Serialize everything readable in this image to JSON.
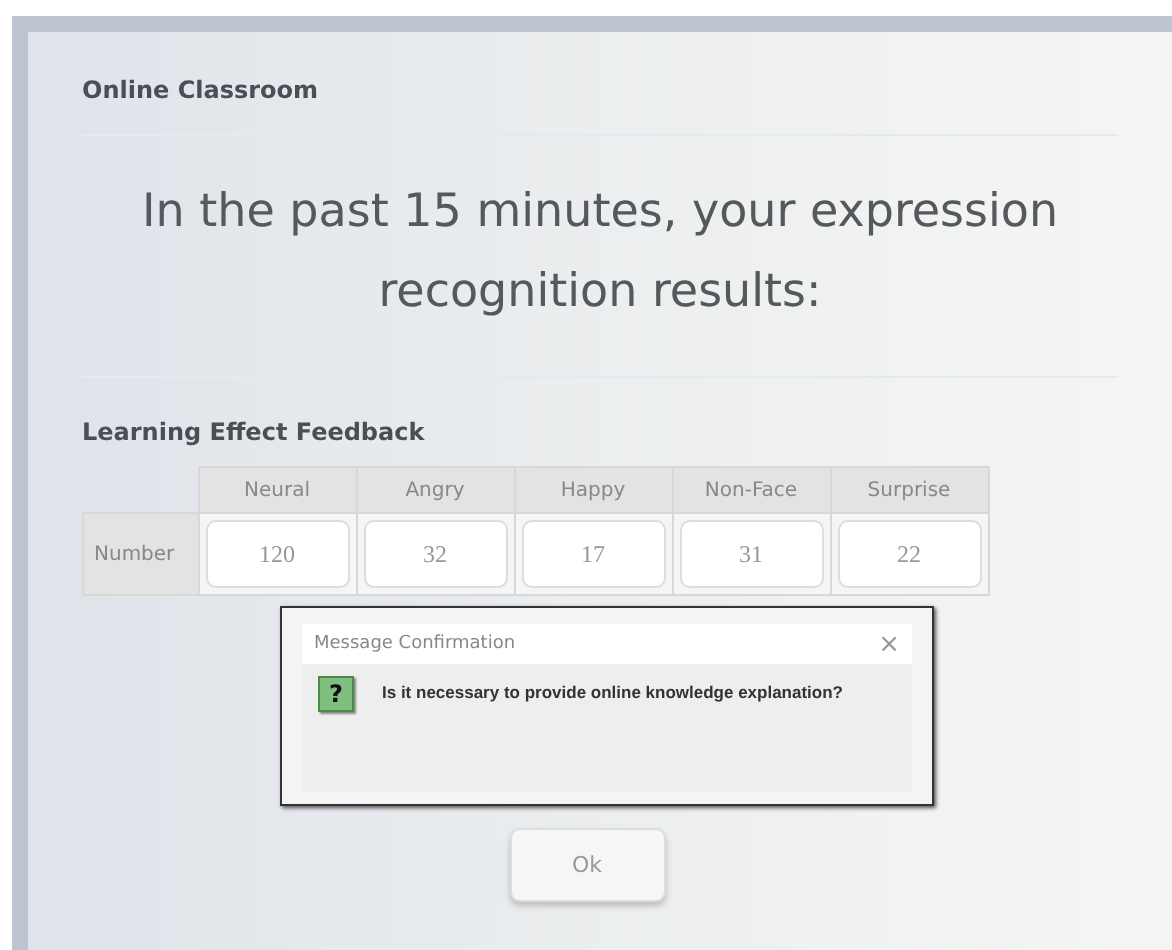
{
  "window": {
    "title": "Online Classroom"
  },
  "heading": "In the past 15 minutes, your expression recognition results:",
  "section_title": "Learning Effect Feedback",
  "table": {
    "columns": [
      "Neural",
      "Angry",
      "Happy",
      "Non-Face",
      "Surprise"
    ],
    "row_label": "Number",
    "values": [
      "120",
      "32",
      "17",
      "31",
      "22"
    ]
  },
  "dialog": {
    "title": "Message Confirmation",
    "close": "×",
    "message": "Is it necessary to provide online knowledge explanation?",
    "icon": "?"
  },
  "button": "Ok"
}
